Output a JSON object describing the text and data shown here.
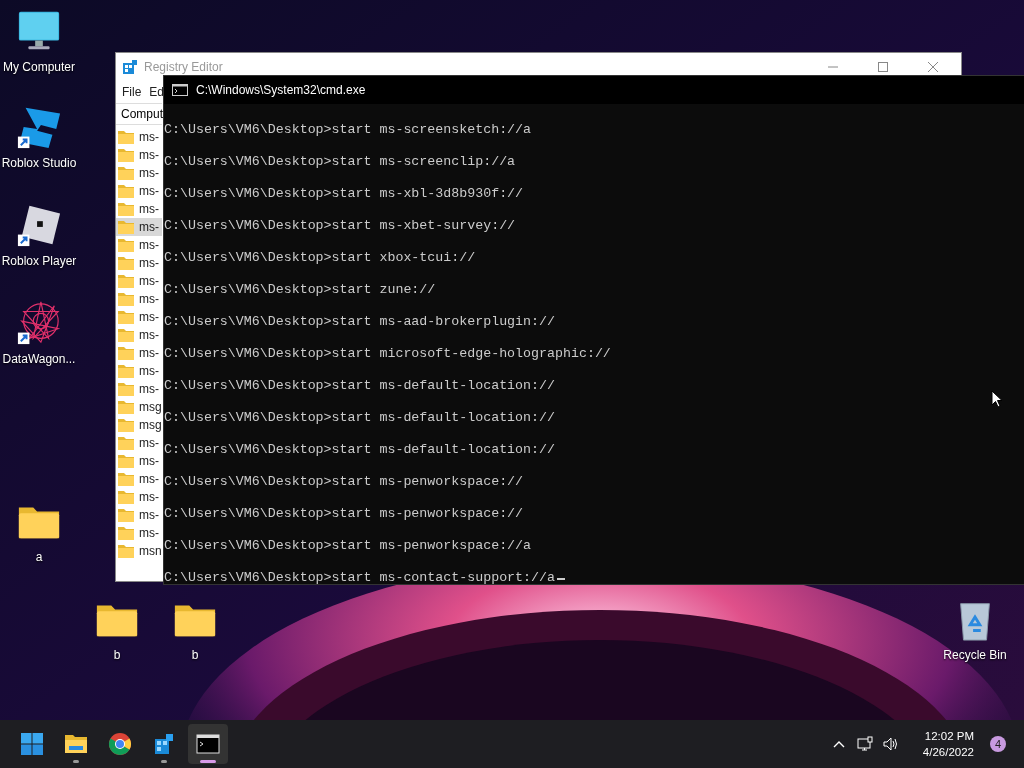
{
  "desktop_icons": [
    {
      "label": "My Computer",
      "kind": "computer",
      "shortcut": false
    },
    {
      "label": "Roblox Studio",
      "kind": "studio",
      "shortcut": true
    },
    {
      "label": "Roblox Player",
      "kind": "player",
      "shortcut": true
    },
    {
      "label": "DataWagon...",
      "kind": "star",
      "shortcut": true
    },
    {
      "label": "a",
      "kind": "folder",
      "shortcut": false
    },
    {
      "label": "b",
      "kind": "folder",
      "shortcut": false
    },
    {
      "label": "b",
      "kind": "folder",
      "shortcut": false
    },
    {
      "label": "Recycle Bin",
      "kind": "bin",
      "shortcut": false
    }
  ],
  "registry_editor": {
    "title": "Registry Editor",
    "menu": [
      "File",
      "Ed"
    ],
    "address": "Comput",
    "items": [
      {
        "label": "ms-",
        "selected": false
      },
      {
        "label": "ms-",
        "selected": false
      },
      {
        "label": "ms-",
        "selected": false
      },
      {
        "label": "ms-",
        "selected": false
      },
      {
        "label": "ms-",
        "selected": false
      },
      {
        "label": "ms-",
        "selected": true
      },
      {
        "label": "ms-",
        "selected": false
      },
      {
        "label": "ms-",
        "selected": false
      },
      {
        "label": "ms-",
        "selected": false
      },
      {
        "label": "ms-",
        "selected": false
      },
      {
        "label": "ms-",
        "selected": false
      },
      {
        "label": "ms-",
        "selected": false
      },
      {
        "label": "ms-",
        "selected": false
      },
      {
        "label": "ms-",
        "selected": false
      },
      {
        "label": "ms-",
        "selected": false
      },
      {
        "label": "msg",
        "selected": false
      },
      {
        "label": "msg",
        "selected": false
      },
      {
        "label": "ms-",
        "selected": false
      },
      {
        "label": "ms-",
        "selected": false
      },
      {
        "label": "ms-",
        "selected": false
      },
      {
        "label": "ms-",
        "selected": false
      },
      {
        "label": "ms-",
        "selected": false
      },
      {
        "label": "ms-",
        "selected": false
      },
      {
        "label": "msn",
        "selected": false
      }
    ]
  },
  "cmd": {
    "title": "C:\\Windows\\System32\\cmd.exe",
    "cursor": true,
    "lines": [
      "C:\\Users\\VM6\\Desktop>start ms-screensketch://a",
      "C:\\Users\\VM6\\Desktop>start ms-screenclip://a",
      "C:\\Users\\VM6\\Desktop>start ms-xbl-3d8b930f://",
      "C:\\Users\\VM6\\Desktop>start ms-xbet-survey://",
      "C:\\Users\\VM6\\Desktop>start xbox-tcui://",
      "C:\\Users\\VM6\\Desktop>start zune://",
      "C:\\Users\\VM6\\Desktop>start ms-aad-brokerplugin://",
      "C:\\Users\\VM6\\Desktop>start microsoft-edge-holographic://",
      "C:\\Users\\VM6\\Desktop>start ms-default-location://",
      "C:\\Users\\VM6\\Desktop>start ms-default-location://",
      "C:\\Users\\VM6\\Desktop>start ms-default-location://",
      "C:\\Users\\VM6\\Desktop>start ms-penworkspace://",
      "C:\\Users\\VM6\\Desktop>start ms-penworkspace://",
      "C:\\Users\\VM6\\Desktop>start ms-penworkspace://a",
      "C:\\Users\\VM6\\Desktop>start ms-contact-support://a"
    ]
  },
  "taskbar": {
    "apps": [
      {
        "kind": "start",
        "running": false,
        "active": false
      },
      {
        "kind": "explorer",
        "running": true,
        "active": false
      },
      {
        "kind": "chrome",
        "running": false,
        "active": false
      },
      {
        "kind": "registry",
        "running": true,
        "active": false
      },
      {
        "kind": "cmd",
        "running": true,
        "active": true
      }
    ],
    "time": "12:02 PM",
    "date": "4/26/2022",
    "notification_count": "4"
  }
}
